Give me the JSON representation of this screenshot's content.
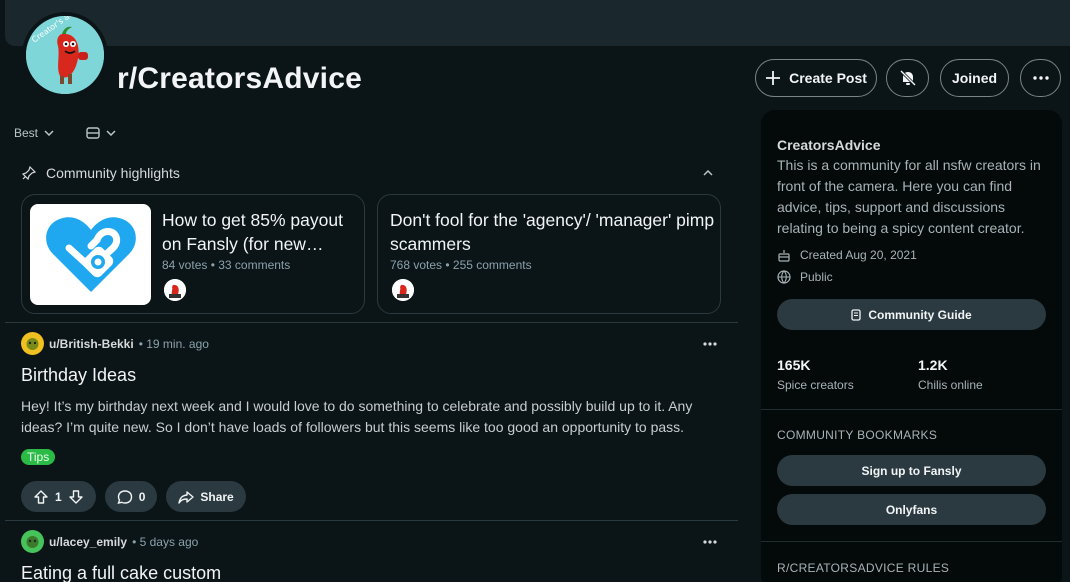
{
  "header": {
    "subreddit": "r/CreatorsAdvice",
    "create_post": "Create Post",
    "joined": "Joined",
    "avatar_text": "Creator's advice"
  },
  "feed": {
    "sort": "Best",
    "highlights_title": "Community highlights",
    "highlights": [
      {
        "title": "How to get 85% payout on Fansly (for new…",
        "meta": "84 votes • 33 comments"
      },
      {
        "title": "Don't fool for the 'agency'/ 'manager' pimp scammers",
        "meta": "768 votes • 255 comments"
      }
    ],
    "posts": [
      {
        "user": "u/British-Bekki",
        "time": "• 19 min. ago",
        "title": "Birthday Ideas",
        "body": "Hey! It’s my birthday next week and I would love to do something to celebrate and possibly build up to it. Any ideas? I’m quite new. So I don’t have loads of followers but this seems like too good an opportunity to pass.",
        "flair": "Tips",
        "votes": "1",
        "comments": "0",
        "share": "Share"
      },
      {
        "user": "u/lacey_emily",
        "time": "• 5 days ago",
        "title": "Eating a full cake custom"
      }
    ]
  },
  "sidebar": {
    "name": "CreatorsAdvice",
    "description": "This is a community for all nsfw creators in front of the camera. Here you can find advice, tips, support and discussions relating to being a spicy content creator.",
    "created": "Created Aug 20, 2021",
    "visibility": "Public",
    "guide_button": "Community Guide",
    "stats": [
      {
        "value": "165K",
        "label": "Spice creators"
      },
      {
        "value": "1.2K",
        "label": "Chilis online"
      }
    ],
    "bookmarks_title": "COMMUNITY BOOKMARKS",
    "bookmarks": [
      "Sign up to Fansly",
      "Onlyfans"
    ],
    "rules_title": "R/CREATORSADVICE RULES"
  },
  "colors": {
    "background": "#0b1416",
    "banner": "#1a282d",
    "button": "#2a3a40",
    "flair": "#2bba46",
    "fansly_blue": "#1fa7f0"
  }
}
